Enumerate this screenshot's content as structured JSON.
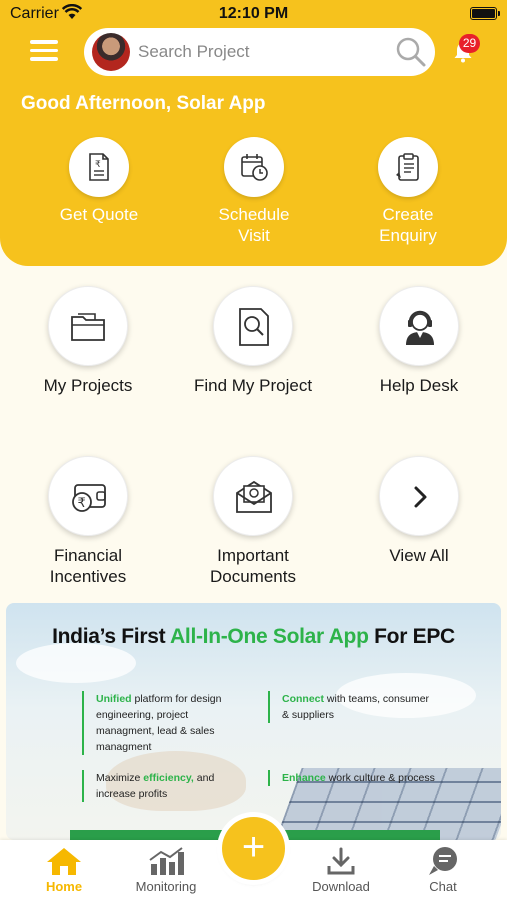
{
  "status_bar": {
    "carrier": "Carrier",
    "time": "12:10 PM"
  },
  "header": {
    "search_placeholder": "Search Project",
    "notification_count": "29",
    "greeting": "Good Afternoon, Solar App"
  },
  "quick_actions": [
    {
      "label": "Get Quote",
      "icon": "quote-document-icon"
    },
    {
      "label": "Schedule Visit",
      "icon": "calendar-clock-icon"
    },
    {
      "label": "Create Enquiry",
      "icon": "clipboard-icon"
    }
  ],
  "tiles": [
    {
      "label": "My Projects",
      "icon": "folder-icon"
    },
    {
      "label": "Find My Project",
      "icon": "document-search-icon"
    },
    {
      "label": "Help Desk",
      "icon": "headset-agent-icon"
    },
    {
      "label": "Financial Incentives",
      "icon": "rupee-wallet-icon"
    },
    {
      "label": "Important Documents",
      "icon": "envelope-document-icon"
    },
    {
      "label": "View All",
      "icon": "chevron-right-icon"
    }
  ],
  "banner": {
    "title_prefix": "India’s First ",
    "title_highlight": "All-In-One Solar App",
    "title_suffix": " For EPC",
    "features": [
      {
        "highlight": "Unified",
        "text": " platform for design engineering, project managment, lead & sales managment"
      },
      {
        "highlight": "Connect",
        "text": " with teams, consumer & suppliers"
      },
      {
        "pre": "Maximize ",
        "highlight": "efficiency,",
        "text": " and increase profits"
      },
      {
        "highlight": "Enhance",
        "text": " work culture & process"
      }
    ]
  },
  "tabbar": {
    "tabs": [
      {
        "label": "Home",
        "active": true
      },
      {
        "label": "Monitoring",
        "active": false
      },
      {
        "label": "Download",
        "active": false
      },
      {
        "label": "Chat",
        "active": false
      }
    ]
  },
  "colors": {
    "brand": "#f6c21d",
    "accent_green": "#2db34a",
    "badge_red": "#e8202a",
    "background": "#fefbef"
  }
}
